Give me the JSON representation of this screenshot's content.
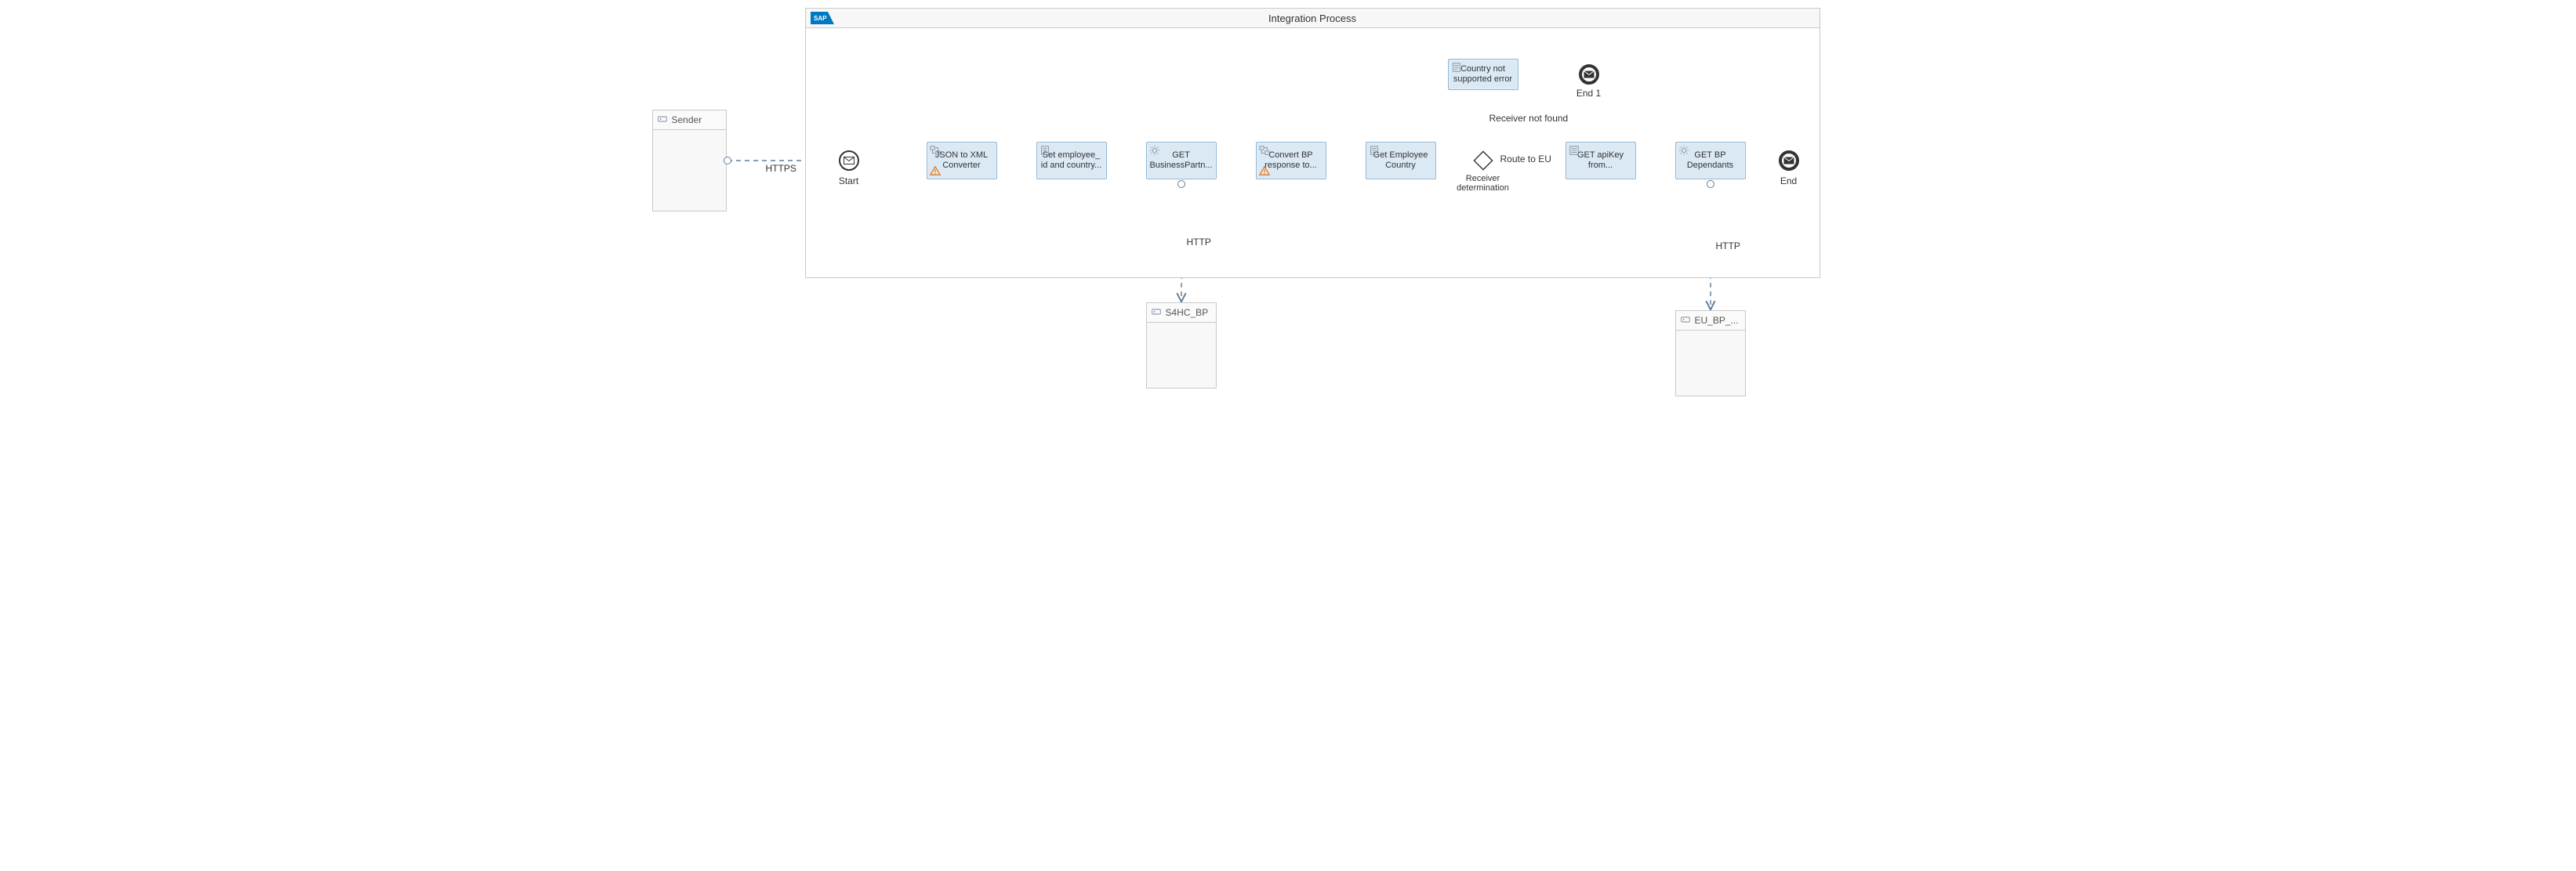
{
  "sender": {
    "title": "Sender"
  },
  "pool": {
    "title": "Integration Process",
    "logo": "SAP"
  },
  "events": {
    "start": {
      "label": "Start"
    },
    "end": {
      "label": "End"
    },
    "end1": {
      "label": "End 1"
    }
  },
  "gateway": {
    "label": "Receiver\ndetermination",
    "route_eu": "Route to EU",
    "route_notfound": "Receiver not found"
  },
  "connectors": {
    "sender_to_start": "HTTPS",
    "bp_to_s4hc": "HTTP",
    "dep_to_eu": "HTTP"
  },
  "steps": {
    "json_xml": {
      "label": "JSON to XML\nConverter",
      "icon": "convert",
      "warn": true
    },
    "set_emp": {
      "label": "Set employee_\nid and country...",
      "icon": "script",
      "warn": false
    },
    "get_bp": {
      "label": "GET\nBusinessPartn...",
      "icon": "gear",
      "warn": false
    },
    "conv_bp": {
      "label": "Convert BP\nresponse to...",
      "icon": "convert",
      "warn": true
    },
    "get_country": {
      "label": "Get Employee\nCountry",
      "icon": "script",
      "warn": false
    },
    "not_supp": {
      "label": "Country not\nsupported error",
      "icon": "script",
      "warn": false
    },
    "get_apikey": {
      "label": "GET apiKey\nfrom...",
      "icon": "list",
      "warn": false
    },
    "get_dep": {
      "label": "GET BP\nDependants",
      "icon": "gear",
      "warn": false
    }
  },
  "externals": {
    "s4hc": {
      "title": "S4HC_BP"
    },
    "eu": {
      "title": "EU_BP_..."
    }
  },
  "colors": {
    "step_fill": "#dbe9f5",
    "step_border": "#8fb6d1",
    "connector": "#5d7e99",
    "sap_logo": "#0079c1",
    "warn": "#e9730c"
  }
}
